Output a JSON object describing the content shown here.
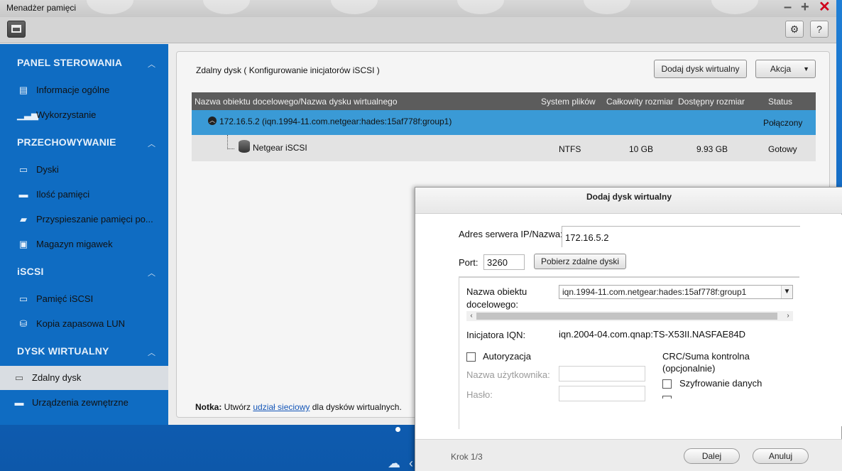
{
  "window": {
    "title": "Menadżer pamięci"
  },
  "sidebar": {
    "sections": [
      {
        "title": "PANEL STEROWANIA",
        "items": [
          "Informacje ogólne",
          "Wykorzystanie"
        ]
      },
      {
        "title": "PRZECHOWYWANIE",
        "items": [
          "Dyski",
          "Ilość pamięci",
          "Przyspieszanie pamięci po...",
          "Magazyn migawek"
        ]
      },
      {
        "title": "iSCSI",
        "items": [
          "Pamięć iSCSI",
          "Kopia zapasowa LUN"
        ]
      },
      {
        "title": "DYSK WIRTUALNY",
        "items": [
          "Zdalny dysk",
          "Urządzenia zewnętrzne"
        ]
      }
    ]
  },
  "main": {
    "title": "Zdalny dysk ( Konfigurowanie inicjatorów iSCSI )",
    "add_button": "Dodaj dysk wirtualny",
    "action_button": "Akcja",
    "columns": [
      "Nazwa obiektu docelowego/Nazwa dysku wirtualnego",
      "System plików",
      "Całkowity rozmiar",
      "Dostępny rozmiar",
      "Status"
    ],
    "rows": [
      {
        "name": "172.16.5.2 (iqn.1994-11.com.netgear:hades:15af778f:group1)",
        "fs": "",
        "total": "",
        "free": "",
        "status": "Połączony"
      },
      {
        "name": "Netgear iSCSI",
        "fs": "NTFS",
        "total": "10 GB",
        "free": "9.93 GB",
        "status": "Gotowy"
      }
    ],
    "note": {
      "prefix": "Notka:",
      "text1": " Utwórz ",
      "link": "udział sieciowy",
      "text2": " dla dysków wirtualnych."
    }
  },
  "dialog": {
    "title": "Dodaj dysk wirtualny",
    "server_label": "Adres serwera IP/Nazwa:",
    "server_value": "172.16.5.2",
    "port_label": "Port:",
    "port_value": "3260",
    "fetch_button": "Pobierz zdalne dyski",
    "target_label_1": "Nazwa obiektu",
    "target_label_2": "docelowego:",
    "target_value": "iqn.1994-11.com.netgear:hades:15af778f:group1",
    "initiator_label": "Inicjatora IQN:",
    "initiator_value": "iqn.2004-04.com.qnap:TS-X53II.NASFAE84D",
    "auth_label": "Autoryzacja",
    "user_label": "Nazwa użytkownika:",
    "pass_label": "Hasło:",
    "crc_label_1": "CRC/Suma kontrolna",
    "crc_label_2": "(opcjonalnie)",
    "encrypt_data": "Szyfrowanie danych",
    "step": "Krok 1/3",
    "next_button": "Dalej",
    "cancel_button": "Anuluj"
  }
}
